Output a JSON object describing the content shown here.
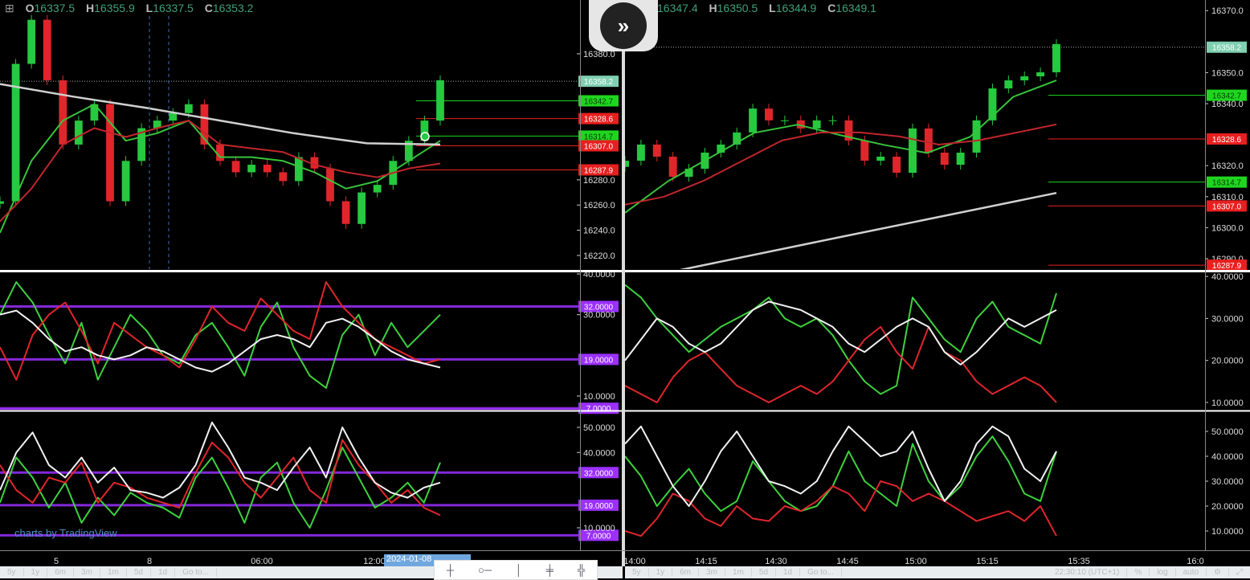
{
  "left_header": {
    "o_label": "O",
    "o": "16337.5",
    "h_label": "H",
    "h": "16355.9",
    "l_label": "L",
    "l": "16337.5",
    "c_label": "C",
    "c": "16353.2"
  },
  "right_header": {
    "o": "16347.4",
    "h_label": "H",
    "h": "16350.5",
    "l_label": "L",
    "l": "16344.9",
    "c_label": "C",
    "c": "16349.1"
  },
  "watermark": "charts by TradingView",
  "date_tag": "2024-01-08",
  "colors": {
    "up": "#26c940",
    "down": "#e0262b",
    "ma_fast": "#37c43c",
    "ma_slow": "#c0262b",
    "ma_long": "#d0d0d0",
    "purple": "#9b30ff",
    "teal_tag": "#7fd0b0"
  },
  "toolbar_left": [
    "5y",
    "1y",
    "6m",
    "3m",
    "1m",
    "5d",
    "1d",
    "Go to..."
  ],
  "toolbar_right": {
    "ranges": [
      "5y",
      "1y",
      "6m",
      "3m",
      "1m",
      "5d",
      "1d",
      "Go to..."
    ],
    "time": "22:30:10 (UTC+1)",
    "percent": "%",
    "log": "log",
    "auto": "auto"
  },
  "chart_data": [
    {
      "type": "line",
      "name": "left-price",
      "y_ticks": [
        "16380.0",
        "16280.0",
        "16260.0",
        "16240.0",
        "16220.0"
      ],
      "y_tick_values": [
        16380,
        16280,
        16260,
        16240,
        16220
      ],
      "x_ticks": [
        "5",
        "8",
        "06:00",
        "12:00"
      ],
      "price_tags": [
        {
          "label": "16358.2",
          "value": 16358.2,
          "color": "#7fd0b0"
        },
        {
          "label": "16342.7",
          "value": 16342.7,
          "color": "#1fd61f"
        },
        {
          "label": "16328.6",
          "value": 16328.6,
          "color": "#e81f1f"
        },
        {
          "label": "16314.7",
          "value": 16314.7,
          "color": "#1fd61f"
        },
        {
          "label": "16307.0",
          "value": 16307.0,
          "color": "#e81f1f"
        },
        {
          "label": "16287.9",
          "value": 16287.9,
          "color": "#e81f1f"
        }
      ],
      "series": [
        {
          "name": "price",
          "values": [
            16263,
            16372,
            16407,
            16359,
            16308,
            16327,
            16340,
            16263,
            16295,
            16321,
            16327,
            16333,
            16340,
            16308,
            16295,
            16286,
            16292,
            16286,
            16279,
            16298,
            16289,
            16263,
            16245,
            16270,
            16276,
            16295,
            16311,
            16327,
            16359
          ]
        },
        {
          "name": "ma-fast",
          "values": [
            16238,
            16295,
            16327,
            16340,
            16311,
            16317,
            16327,
            16298,
            16298,
            16295,
            16286,
            16273,
            16279,
            16295,
            16311
          ]
        },
        {
          "name": "ma-slow",
          "values": [
            16247,
            16273,
            16308,
            16321,
            16314,
            16321,
            16327,
            16308,
            16305,
            16302,
            16292,
            16286,
            16282,
            16289,
            16293
          ]
        },
        {
          "name": "ma-long",
          "values": [
            16356,
            16346,
            16337,
            16327,
            16317,
            16309,
            16308
          ]
        }
      ]
    },
    {
      "type": "line",
      "name": "left-osc-1",
      "y_ticks": [
        "40.0000",
        "30.0000",
        "10.0000"
      ],
      "y_tick_values": [
        40,
        30,
        10
      ],
      "levels": [
        {
          "label": "32.0000",
          "value": 32
        },
        {
          "label": "19.0000",
          "value": 19
        },
        {
          "label": "7.0000",
          "value": 7
        }
      ],
      "series": [
        {
          "name": "green",
          "values": [
            30,
            38,
            33,
            25,
            18,
            28,
            14,
            22,
            30,
            26,
            20,
            18,
            25,
            28,
            22,
            15,
            27,
            33,
            22,
            15,
            12,
            25,
            30,
            20,
            28,
            22,
            26,
            30
          ]
        },
        {
          "name": "red",
          "values": [
            22,
            14,
            25,
            30,
            33,
            26,
            18,
            28,
            25,
            22,
            20,
            17,
            24,
            32,
            28,
            26,
            34,
            30,
            26,
            24,
            38,
            32,
            28,
            24,
            22,
            20,
            18,
            19
          ]
        },
        {
          "name": "white",
          "values": [
            30,
            31,
            28,
            24,
            21,
            22,
            20,
            19,
            20,
            22,
            21,
            19,
            17,
            16,
            18,
            21,
            24,
            25,
            24,
            22,
            28,
            29,
            27,
            24,
            21,
            19,
            18,
            17
          ]
        }
      ]
    },
    {
      "type": "line",
      "name": "left-osc-2",
      "y_ticks": [
        "50.0000",
        "40.0000",
        "10.0000"
      ],
      "y_tick_values": [
        50,
        40,
        10
      ],
      "levels": [
        {
          "label": "32.0000",
          "value": 32
        },
        {
          "label": "19.0000",
          "value": 19
        },
        {
          "label": "7.0000",
          "value": 7
        }
      ],
      "series": [
        {
          "name": "green",
          "values": [
            20,
            38,
            30,
            18,
            28,
            12,
            22,
            15,
            24,
            20,
            18,
            14,
            30,
            38,
            26,
            12,
            30,
            36,
            20,
            10,
            25,
            42,
            30,
            18,
            22,
            28,
            20,
            36
          ]
        },
        {
          "name": "red",
          "values": [
            35,
            25,
            20,
            30,
            28,
            36,
            20,
            28,
            26,
            22,
            20,
            18,
            32,
            44,
            38,
            28,
            22,
            30,
            38,
            25,
            20,
            45,
            35,
            28,
            20,
            25,
            18,
            15
          ]
        },
        {
          "name": "white",
          "values": [
            25,
            40,
            48,
            35,
            30,
            38,
            28,
            34,
            25,
            24,
            22,
            26,
            35,
            52,
            42,
            30,
            28,
            25,
            34,
            42,
            30,
            50,
            38,
            28,
            24,
            22,
            26,
            28
          ]
        }
      ]
    },
    {
      "type": "line",
      "name": "right-price",
      "y_ticks": [
        "16370.0",
        "16350.0",
        "16340.0",
        "16320.0",
        "16310.0",
        "16300.0",
        "16290.0"
      ],
      "y_tick_values": [
        16370,
        16350,
        16340,
        16320,
        16310,
        16300,
        16290
      ],
      "x_ticks": [
        "14:00",
        "14:15",
        "14:30",
        "14:45",
        "15:00",
        "15:15",
        "15:35",
        "16:0"
      ],
      "price_tags": [
        {
          "label": "16358.2",
          "value": 16358.2,
          "color": "#7fd0b0"
        },
        {
          "label": "16342.7",
          "value": 16342.7,
          "color": "#1fd61f"
        },
        {
          "label": "16328.6",
          "value": 16328.6,
          "color": "#e81f1f"
        },
        {
          "label": "16314.7",
          "value": 16314.7,
          "color": "#1fd61f"
        },
        {
          "label": "16307.0",
          "value": 16307.0,
          "color": "#e81f1f"
        },
        {
          "label": "16287.9",
          "value": 16287.9,
          "color": "#e81f1f"
        }
      ],
      "series": [
        {
          "name": "price",
          "values": [
            16321.6,
            16326.8,
            16322.9,
            16316.4,
            16319.0,
            16324.2,
            16326.8,
            16330.7,
            16338.4,
            16334.6,
            16334.6,
            16332.0,
            16334.6,
            16334.6,
            16328.1,
            16321.6,
            16322.9,
            16317.7,
            16332.0,
            16324.2,
            16320.3,
            16324.2,
            16334.6,
            16344.9,
            16347.5,
            16348.8,
            16350.1,
            16359.2
          ]
        },
        {
          "name": "ma-fast",
          "values": [
            16304.8,
            16315.0,
            16322.8,
            16330.6,
            16333.2,
            16329.8,
            16326.7,
            16324.1,
            16329.3,
            16342.2,
            16347.5
          ]
        },
        {
          "name": "ma-slow",
          "values": [
            16307.4,
            16310.0,
            16315.1,
            16321.6,
            16328.1,
            16330.7,
            16330.7,
            16329.4,
            16326.8,
            16328.1,
            16330.7,
            16333.3
          ]
        },
        {
          "name": "ma-long",
          "values": [
            16282.7,
            16297.0,
            16311.2
          ]
        }
      ]
    },
    {
      "type": "line",
      "name": "right-osc-1",
      "y_ticks": [
        "40.0000",
        "30.0000",
        "20.0000",
        "10.0000"
      ],
      "y_tick_values": [
        40,
        30,
        20,
        10
      ],
      "series": [
        {
          "name": "green",
          "values": [
            38,
            35,
            30,
            26,
            22,
            25,
            28,
            30,
            32,
            35,
            30,
            28,
            30,
            26,
            20,
            15,
            12,
            14,
            35,
            30,
            25,
            22,
            30,
            34,
            28,
            26,
            24,
            36
          ]
        },
        {
          "name": "red",
          "values": [
            14,
            12,
            10,
            16,
            20,
            22,
            18,
            14,
            12,
            10,
            12,
            14,
            12,
            15,
            20,
            25,
            28,
            22,
            18,
            28,
            22,
            20,
            15,
            12,
            14,
            16,
            14,
            10
          ]
        },
        {
          "name": "white",
          "values": [
            20,
            25,
            30,
            28,
            24,
            22,
            24,
            28,
            32,
            34,
            33,
            32,
            30,
            28,
            24,
            22,
            25,
            28,
            30,
            28,
            22,
            19,
            22,
            26,
            30,
            28,
            30,
            32
          ]
        }
      ]
    },
    {
      "type": "line",
      "name": "right-osc-2",
      "y_ticks": [
        "50.0000",
        "40.0000",
        "30.0000",
        "20.0000",
        "10.0000"
      ],
      "y_tick_values": [
        50,
        40,
        30,
        20,
        10
      ],
      "series": [
        {
          "name": "green",
          "values": [
            40,
            32,
            20,
            28,
            35,
            25,
            18,
            22,
            38,
            30,
            22,
            18,
            20,
            28,
            42,
            30,
            25,
            20,
            45,
            30,
            22,
            28,
            40,
            48,
            38,
            25,
            22,
            42
          ]
        },
        {
          "name": "red",
          "values": [
            10,
            8,
            15,
            25,
            22,
            15,
            12,
            20,
            15,
            14,
            20,
            18,
            22,
            28,
            25,
            18,
            30,
            28,
            22,
            25,
            22,
            18,
            14,
            16,
            18,
            14,
            20,
            8
          ]
        },
        {
          "name": "white",
          "values": [
            45,
            52,
            40,
            28,
            20,
            30,
            42,
            50,
            40,
            30,
            28,
            25,
            30,
            42,
            52,
            46,
            40,
            42,
            50,
            35,
            22,
            30,
            45,
            52,
            48,
            35,
            30,
            42
          ]
        }
      ]
    }
  ]
}
